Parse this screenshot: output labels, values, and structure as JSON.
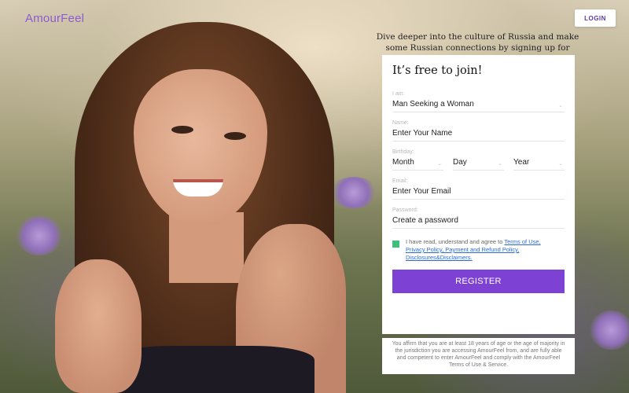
{
  "header": {
    "logo": "AmourFeel",
    "login_label": "LOGIN"
  },
  "tagline": "Dive deeper into the culture of Russia and make some Russian connections by signing up for AmourFeel",
  "form": {
    "title": "It’s free to join!",
    "iam": {
      "label": "I am:",
      "value": "Man Seeking a Woman"
    },
    "name": {
      "label": "Name:",
      "value": "Enter Your Name"
    },
    "birthday": {
      "label": "Birthday:",
      "month": "Month",
      "day": "Day",
      "year": "Year"
    },
    "email": {
      "label": "Email:",
      "value": "Enter Your Email"
    },
    "password": {
      "label": "Password:",
      "value": "Create a password"
    },
    "agree": {
      "prefix": "I have read, understand and agree to ",
      "terms_link": "Terms of Use,",
      "privacy_link": "Privacy Policy, Payment and Refund Policy,",
      "disclosures_link": "Disclosures&Disclaimers."
    },
    "register_label": "REGISTER"
  },
  "disclaimer": "You affirm that you are at least 18 years of age or the age of majority in the jurisdiction you are accessing AmourFeel from, and are fully able and competent to enter AmourFeel and comply with the AmourFeel Terms of Use & Service.",
  "icons": {
    "select_caret": "⌄"
  },
  "colors": {
    "brand_purple": "#8e5bd0",
    "register_button": "#7d42d4",
    "checkbox_checked": "#3dc07b",
    "link": "#2a6ad6"
  }
}
